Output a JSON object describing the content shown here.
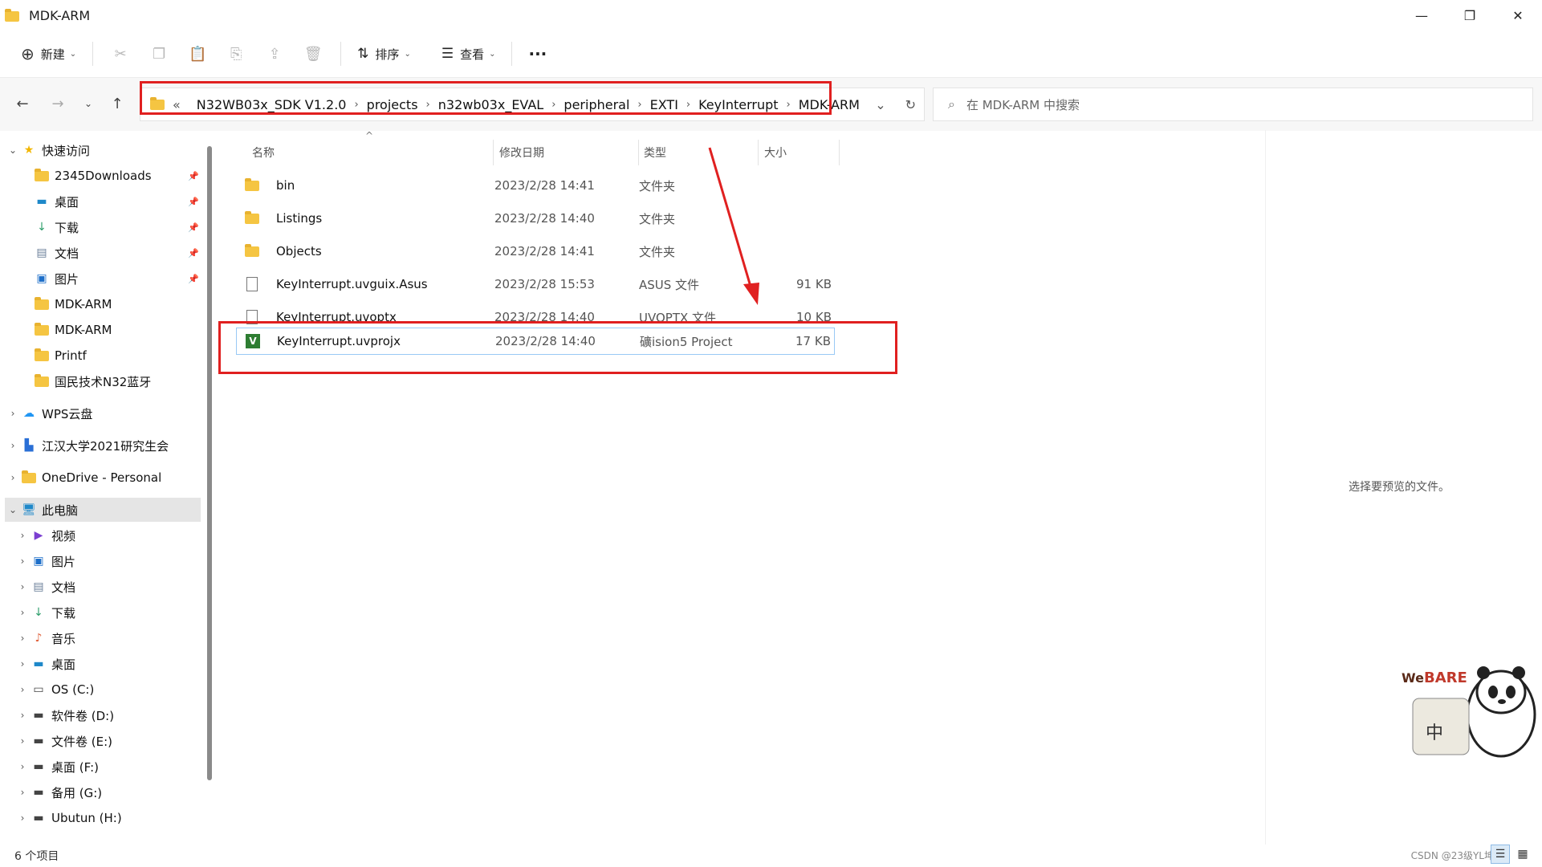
{
  "window": {
    "title": "MDK-ARM",
    "minimize": "—",
    "restore": "❐",
    "close": "✕"
  },
  "toolbar": {
    "new_label": "新建",
    "sort_label": "排序",
    "view_label": "查看",
    "more": "···"
  },
  "address": {
    "prefix": "«",
    "crumbs": [
      "N32WB03x_SDK V1.2.0",
      "projects",
      "n32wb03x_EVAL",
      "peripheral",
      "EXTI",
      "KeyInterrupt",
      "MDK-ARM"
    ]
  },
  "search": {
    "placeholder": "在 MDK-ARM 中搜索"
  },
  "sidebar": {
    "quick_access": "快速访问",
    "quick_items": [
      "2345Downloads",
      "桌面",
      "下载",
      "文档",
      "图片",
      "MDK-ARM",
      "MDK-ARM",
      "Printf",
      "国民技术N32蓝牙"
    ],
    "wps": "WPS云盘",
    "jhu": "江汉大学2021研究生会",
    "onedrive": "OneDrive - Personal",
    "this_pc": "此电脑",
    "pc_items": [
      "视频",
      "图片",
      "文档",
      "下载",
      "音乐",
      "桌面",
      "OS (C:)",
      "软件卷 (D:)",
      "文件卷 (E:)",
      "桌面 (F:)",
      "备用 (G:)",
      "Ubutun (H:)"
    ]
  },
  "columns": {
    "name": "名称",
    "date": "修改日期",
    "type": "类型",
    "size": "大小"
  },
  "files": [
    {
      "name": "bin",
      "date": "2023/2/28 14:41",
      "type": "文件夹",
      "size": "",
      "kind": "folder"
    },
    {
      "name": "Listings",
      "date": "2023/2/28 14:40",
      "type": "文件夹",
      "size": "",
      "kind": "folder"
    },
    {
      "name": "Objects",
      "date": "2023/2/28 14:41",
      "type": "文件夹",
      "size": "",
      "kind": "folder"
    },
    {
      "name": "KeyInterrupt.uvguix.Asus",
      "date": "2023/2/28 15:53",
      "type": "ASUS 文件",
      "size": "91 KB",
      "kind": "file"
    },
    {
      "name": "KeyInterrupt.uvoptx",
      "date": "2023/2/28 14:40",
      "type": "UVOPTX 文件",
      "size": "10 KB",
      "kind": "file"
    },
    {
      "name": "KeyInterrupt.uvprojx",
      "date": "2023/2/28 14:40",
      "type": "礦ision5 Project",
      "size": "17 KB",
      "kind": "uv"
    }
  ],
  "preview": {
    "text": "选择要预览的文件。"
  },
  "status": {
    "count": "6 个项目",
    "watermark": "CSDN @23级YL坤"
  },
  "colors": {
    "highlight": "#e02020",
    "selection": "#99c9f5"
  }
}
